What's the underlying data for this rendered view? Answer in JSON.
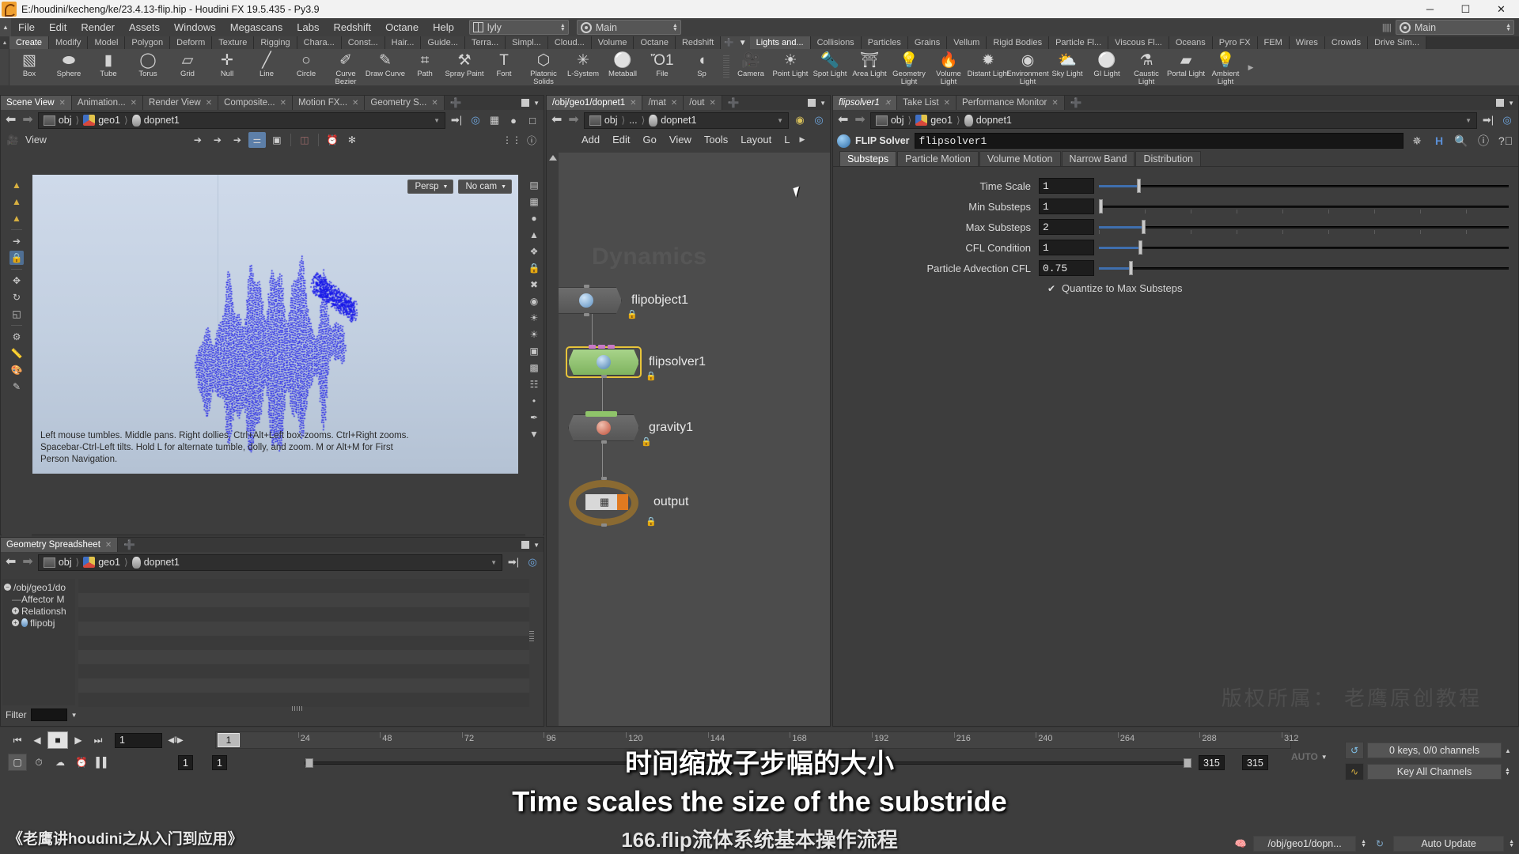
{
  "window": {
    "title": "E:/houdini/kecheng/ke/23.4.13-flip.hip - Houdini FX 19.5.435 - Py3.9",
    "app_icon": "houdini-logo-icon",
    "minimize": "─",
    "maximize": "☐",
    "close": "✕"
  },
  "menubar": {
    "items": [
      "File",
      "Edit",
      "Render",
      "Assets",
      "Windows",
      "Megascans",
      "Labs",
      "Redshift",
      "Octane",
      "Help"
    ],
    "desktop": {
      "value": "lyly",
      "icon": "layout-icon"
    },
    "viewport_layout": {
      "value": "Main",
      "icon": "target-icon"
    }
  },
  "shelf": {
    "tabs_left": [
      "Create",
      "Modify",
      "Model",
      "Polygon",
      "Deform",
      "Texture",
      "Rigging",
      "Chara...",
      "Const...",
      "Hair...",
      "Guide...",
      "Terra...",
      "Simpl...",
      "Cloud...",
      "Volume",
      "Octane",
      "Redshift"
    ],
    "tabs_right": [
      "Lights and...",
      "Collisions",
      "Particles",
      "Grains",
      "Vellum",
      "Rigid Bodies",
      "Particle Fl...",
      "Viscous Fl...",
      "Oceans",
      "Pyro FX",
      "FEM",
      "Wires",
      "Crowds",
      "Drive Sim..."
    ],
    "active_left": "Create",
    "active_right": "Lights and...",
    "add_tab": "+",
    "tools_left": [
      {
        "label": "Box",
        "icon": "box-icon",
        "glyph": "▧"
      },
      {
        "label": "Sphere",
        "icon": "sphere-icon",
        "glyph": "⬬"
      },
      {
        "label": "Tube",
        "icon": "tube-icon",
        "glyph": "▮"
      },
      {
        "label": "Torus",
        "icon": "torus-icon",
        "glyph": "◯"
      },
      {
        "label": "Grid",
        "icon": "grid-icon",
        "glyph": "▱"
      },
      {
        "label": "Null",
        "icon": "null-icon",
        "glyph": "✛"
      },
      {
        "label": "Line",
        "icon": "line-icon",
        "glyph": "╱"
      },
      {
        "label": "Circle",
        "icon": "circle-icon",
        "glyph": "○"
      },
      {
        "label": "Curve Bezier",
        "icon": "curve-bezier-icon",
        "glyph": "✐"
      },
      {
        "label": "Draw Curve",
        "icon": "draw-curve-icon",
        "glyph": "✎"
      },
      {
        "label": "Path",
        "icon": "path-icon",
        "glyph": "⌗"
      },
      {
        "label": "Spray Paint",
        "icon": "spray-paint-icon",
        "glyph": "⚒"
      },
      {
        "label": "Font",
        "icon": "font-icon",
        "glyph": "T"
      },
      {
        "label": "Platonic Solids",
        "icon": "platonic-solids-icon",
        "glyph": "⬡"
      },
      {
        "label": "L-System",
        "icon": "l-system-icon",
        "glyph": "✳"
      },
      {
        "label": "Metaball",
        "icon": "metaball-icon",
        "glyph": "⚪"
      },
      {
        "label": "File",
        "icon": "file-icon",
        "glyph": "Ὄ1"
      },
      {
        "label": "Sp",
        "icon": "sphere-partial-icon",
        "glyph": "◖"
      }
    ],
    "tools_right": [
      {
        "label": "Camera",
        "icon": "camera-icon",
        "glyph": "🎥"
      },
      {
        "label": "Point Light",
        "icon": "point-light-icon",
        "glyph": "☀"
      },
      {
        "label": "Spot Light",
        "icon": "spot-light-icon",
        "glyph": "🔦"
      },
      {
        "label": "Area Light",
        "icon": "area-light-icon",
        "glyph": "⛩"
      },
      {
        "label": "Geometry Light",
        "icon": "geometry-light-icon",
        "glyph": "💡"
      },
      {
        "label": "Volume Light",
        "icon": "volume-light-icon",
        "glyph": "🔥"
      },
      {
        "label": "Distant Light",
        "icon": "distant-light-icon",
        "glyph": "✹"
      },
      {
        "label": "Environment Light",
        "icon": "environment-light-icon",
        "glyph": "◉"
      },
      {
        "label": "Sky Light",
        "icon": "sky-light-icon",
        "glyph": "⛅"
      },
      {
        "label": "GI Light",
        "icon": "gi-light-icon",
        "glyph": "⚪"
      },
      {
        "label": "Caustic Light",
        "icon": "caustic-light-icon",
        "glyph": "⚗"
      },
      {
        "label": "Portal Light",
        "icon": "portal-light-icon",
        "glyph": "▰"
      },
      {
        "label": "Ambient Light",
        "icon": "ambient-light-icon",
        "glyph": "💡"
      }
    ]
  },
  "scene_pane": {
    "tabs": [
      {
        "label": "Scene View",
        "active": true
      },
      {
        "label": "Animation...",
        "active": false
      },
      {
        "label": "Render View",
        "active": false
      },
      {
        "label": "Composite...",
        "active": false
      },
      {
        "label": "Motion FX...",
        "active": false
      },
      {
        "label": "Geometry S...",
        "active": false
      }
    ],
    "path": [
      "obj",
      "geo1",
      "dopnet1"
    ],
    "viewtoolbar": {
      "label": "View",
      "buttons": [
        "select-arrow-icon",
        "handle-arrow-icon",
        "camera-arrow-icon",
        "snapshot-icon",
        "display-icon",
        "ghost-icon",
        "timer-icon",
        "gear-icon"
      ],
      "right_buttons": [
        "viewport-layout-icon",
        "help-icon"
      ]
    },
    "viewport": {
      "persp_badge": "Persp",
      "cam_badge": "No cam",
      "help_text": "Left mouse tumbles. Middle pans. Right dollies. Ctrl+Alt+Left box-zooms. Ctrl+Right zooms. Spacebar-Ctrl-Left tilts. Hold L for alternate tumble, dolly, and zoom.    M or Alt+M for First Person Navigation."
    }
  },
  "network_pane": {
    "tabs": [
      {
        "label": "/obj/geo1/dopnet1",
        "active": true
      },
      {
        "label": "/mat",
        "active": false
      },
      {
        "label": "/out",
        "active": false
      }
    ],
    "path": [
      "obj",
      "...",
      "dopnet1"
    ],
    "menu": [
      "Add",
      "Edit",
      "Go",
      "View",
      "Tools",
      "Layout",
      "L"
    ],
    "watermark": "Dynamics",
    "nodes": [
      {
        "name": "flipobject1",
        "type": "flipobject",
        "selected": false,
        "color": "grey",
        "locked": true
      },
      {
        "name": "flipsolver1",
        "type": "flipsolver",
        "selected": true,
        "color": "green",
        "locked": true
      },
      {
        "name": "gravity1",
        "type": "gravity",
        "selected": false,
        "color": "grey",
        "locked": true
      },
      {
        "name": "output",
        "type": "output",
        "selected": false,
        "color": "ring",
        "locked": true
      }
    ]
  },
  "param_pane": {
    "tabs": [
      {
        "label": "flipsolver1",
        "active": true,
        "italic": true
      },
      {
        "label": "Take List",
        "active": false,
        "italic": false
      },
      {
        "label": "Performance Monitor",
        "active": false,
        "italic": false
      }
    ],
    "path": [
      "obj",
      "geo1",
      "dopnet1"
    ],
    "node_type": "FLIP Solver",
    "node_name": "flipsolver1",
    "header_icons": [
      "asterisk-icon",
      "houdini-h-icon",
      "search-icon",
      "info-icon",
      "help-icon"
    ],
    "tabs_row": [
      "Substeps",
      "Particle Motion",
      "Volume Motion",
      "Narrow Band",
      "Distribution"
    ],
    "active_tab": "Substeps",
    "params": [
      {
        "label": "Time Scale",
        "value": "1",
        "slider_pct": 9.5,
        "knob_pct": 9.7,
        "ticks": false
      },
      {
        "label": "Min Substeps",
        "value": "1",
        "slider_pct": 0.0,
        "knob_pct": 0.3,
        "ticks": true
      },
      {
        "label": "Max Substeps",
        "value": "2",
        "slider_pct": 10.5,
        "knob_pct": 10.8,
        "ticks": true
      },
      {
        "label": "CFL Condition",
        "value": "1",
        "slider_pct": 9.8,
        "knob_pct": 10.0,
        "ticks": false
      },
      {
        "label": "Particle Advection CFL",
        "value": "0.75",
        "slider_pct": 7.5,
        "knob_pct": 7.7,
        "ticks": false
      }
    ],
    "checkbox": {
      "label": "Quantize to Max Substeps",
      "checked": true,
      "mark": "✔"
    },
    "watermark": "版权所属： 老鹰原创教程"
  },
  "spreadsheet_pane": {
    "tabs": [
      {
        "label": "Geometry Spreadsheet",
        "active": true
      }
    ],
    "path": [
      "obj",
      "geo1",
      "dopnet1"
    ],
    "tree": [
      {
        "label": "/obj/geo1/do",
        "expander": "−",
        "depth": 0,
        "icon": "none"
      },
      {
        "label": "Affector M",
        "expander": "",
        "depth": 1,
        "icon": "none"
      },
      {
        "label": "Relationsh",
        "expander": "+",
        "depth": 1,
        "icon": "none"
      },
      {
        "label": "flipobj",
        "expander": "+",
        "depth": 1,
        "icon": "flipobject-icon"
      }
    ],
    "filter_label": "Filter",
    "filter_value": ""
  },
  "playbar": {
    "transport": [
      "⏮",
      "◀",
      "■",
      "▶",
      "⏭"
    ],
    "current_frame": "1",
    "step_controls": "◀‖▶",
    "playhead_frame": "1",
    "ruler_ticks": [
      "24",
      "48",
      "72",
      "96",
      "120",
      "144",
      "168",
      "192",
      "216",
      "240",
      "264",
      "288",
      "312"
    ],
    "range_start": "1",
    "range_start2": "1",
    "range_end": "315",
    "range_end2": "315",
    "auto_label": "AUTO",
    "keys_text": "0 keys, 0/0 channels",
    "key_channels": "Key All Channels",
    "status_path": "/obj/geo1/dopn...",
    "auto_update": "Auto Update",
    "bottom_icons": [
      "snapshot-icon",
      "realtime-icon",
      "skin-icon",
      "clock-icon",
      "audio-icon"
    ]
  },
  "subtitles": {
    "chinese": "时间缩放子步幅的大小",
    "english": "Time scales the size of the substride",
    "bottom_left": "《老鹰讲houdini之从入门到应用》",
    "bottom_title": "166.flip流体系统基本操作流程"
  },
  "colors": {
    "accent_blue": "#3f6fae",
    "node_green": "#8fc46a",
    "node_select": "#e8c43a",
    "output_ring": "#8a6a32",
    "panel_bg": "#3d3d3d",
    "viewport_top": "#cfdaea",
    "particle_blue": "#1818e8"
  }
}
